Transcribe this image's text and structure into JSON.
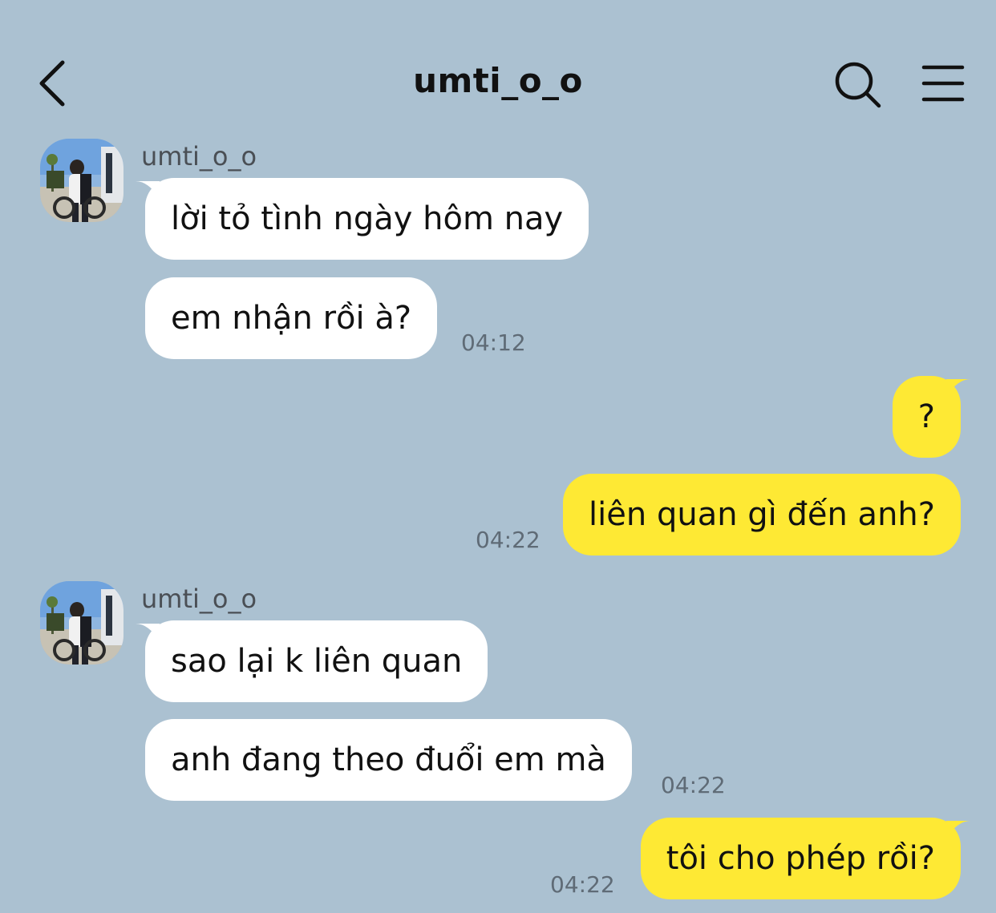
{
  "header": {
    "title": "umti_o_o",
    "back_icon": "chevron-left-icon",
    "search_icon": "search-icon",
    "menu_icon": "hamburger-menu-icon"
  },
  "colors": {
    "background": "#abc1d1",
    "incoming_bubble": "#ffffff",
    "outgoing_bubble": "#fee934",
    "timestamp": "#5f6b76"
  },
  "groups": [
    {
      "sender": "umti_o_o",
      "messages": [
        "lời tỏ tình ngày hôm nay",
        "em nhận rồi à?"
      ],
      "time": "04:12"
    },
    {
      "sender": "me",
      "messages": [
        "?",
        "liên quan gì đến anh?"
      ],
      "time": "04:22"
    },
    {
      "sender": "umti_o_o",
      "messages": [
        "sao lại k liên quan",
        "anh đang theo đuổi em mà"
      ],
      "time": "04:22"
    },
    {
      "sender": "me",
      "messages": [
        "tôi cho phép rồi?"
      ],
      "time": "04:22"
    }
  ]
}
